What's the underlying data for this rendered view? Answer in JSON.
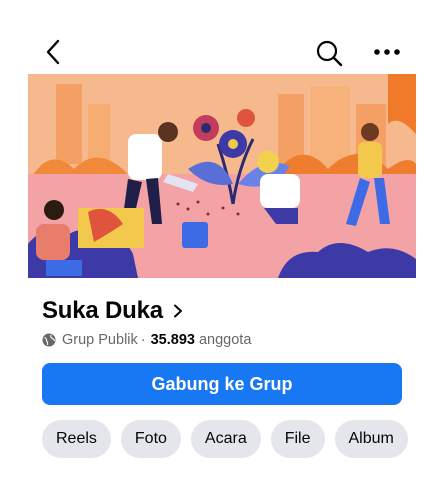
{
  "header": {
    "back_icon": "chevron-left-icon",
    "search_icon": "search-icon",
    "more_icon": "more-horizontal-icon"
  },
  "group": {
    "name": "Suka Duka",
    "privacy": "Grup Publik",
    "separator": "·",
    "member_count": "35.893",
    "member_suffix": "anggota"
  },
  "actions": {
    "join_label": "Gabung ke Grup"
  },
  "tabs": [
    {
      "label": "Reels"
    },
    {
      "label": "Foto"
    },
    {
      "label": "Acara"
    },
    {
      "label": "File"
    },
    {
      "label": "Album"
    }
  ],
  "colors": {
    "primary": "#1877f2",
    "chip_bg": "#e4e6eb",
    "muted_text": "#65676b"
  }
}
